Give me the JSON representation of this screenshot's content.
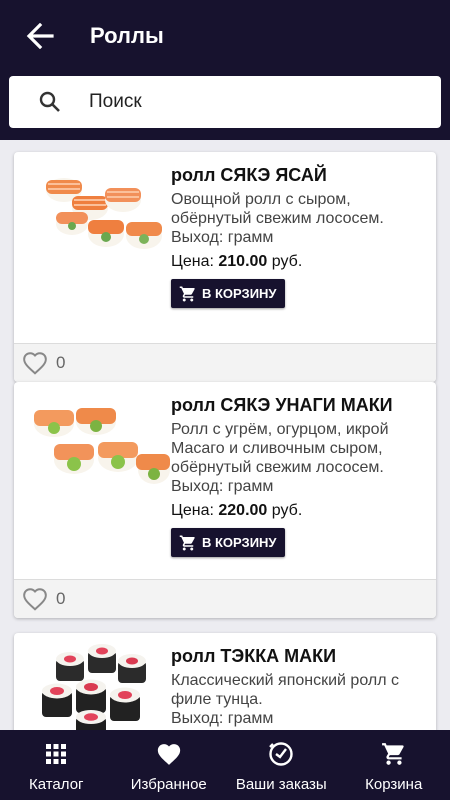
{
  "header": {
    "title": "Роллы",
    "back_icon": "arrow-left-icon"
  },
  "search": {
    "placeholder": "Поиск",
    "icon": "search-icon"
  },
  "products": [
    {
      "name": "ролл СЯКЭ ЯСАЙ",
      "description": "Овощной ролл с сыром, обёрнутый свежим лососем.",
      "output": "Выход: грамм",
      "price_label": "Цена:",
      "price": "210.00",
      "currency": "руб.",
      "cart_button": "В КОРЗИНУ",
      "likes": "0"
    },
    {
      "name": "ролл СЯКЭ УНАГИ МАКИ",
      "description": "Ролл с угрём, огурцом, икрой Масаго и сливочным сыром, обёрнутый свежим лососем.",
      "output": "Выход: грамм",
      "price_label": "Цена:",
      "price": "220.00",
      "currency": "руб.",
      "cart_button": "В КОРЗИНУ",
      "likes": "0"
    },
    {
      "name": "ролл ТЭККА МАКИ",
      "description": "Классический японский ролл с филе тунца.",
      "output": "Выход: грамм"
    }
  ],
  "bottom_nav": [
    {
      "label": "Каталог",
      "icon": "grid-icon"
    },
    {
      "label": "Избранное",
      "icon": "heart-icon"
    },
    {
      "label": "Ваши заказы",
      "icon": "orders-icon"
    },
    {
      "label": "Корзина",
      "icon": "cart-icon"
    }
  ],
  "colors": {
    "primary": "#17122e",
    "background": "#ececf1",
    "card": "#ffffff",
    "salmon": "#f08a4b"
  }
}
